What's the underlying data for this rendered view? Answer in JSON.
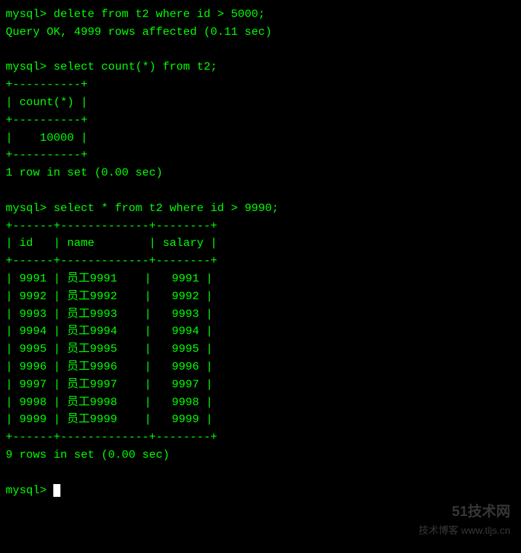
{
  "block1": {
    "prompt": "mysql> ",
    "command": "delete from t2 where id > 5000;",
    "result": "Query OK, 4999 rows affected (0.11 sec)"
  },
  "block2": {
    "prompt": "mysql> ",
    "command": "select count(*) from t2;",
    "border": "+----------+",
    "header": "| count(*) |",
    "row": "|    10000 |",
    "summary": "1 row in set (0.00 sec)",
    "chart_data": {
      "type": "table",
      "columns": [
        "count(*)"
      ],
      "rows": [
        [
          10000
        ]
      ]
    }
  },
  "block3": {
    "prompt": "mysql> ",
    "command": "select * from t2 where id > 9990;",
    "border": "+------+-------------+--------+",
    "header": "| id   | name        | salary |",
    "rows": [
      "| 9991 | 员工9991    |   9991 |",
      "| 9992 | 员工9992    |   9992 |",
      "| 9993 | 员工9993    |   9993 |",
      "| 9994 | 员工9994    |   9994 |",
      "| 9995 | 员工9995    |   9995 |",
      "| 9996 | 员工9996    |   9996 |",
      "| 9997 | 员工9997    |   9997 |",
      "| 9998 | 员工9998    |   9998 |",
      "| 9999 | 员工9999    |   9999 |"
    ],
    "summary": "9 rows in set (0.00 sec)",
    "chart_data": {
      "type": "table",
      "columns": [
        "id",
        "name",
        "salary"
      ],
      "rows": [
        [
          9991,
          "员工9991",
          9991
        ],
        [
          9992,
          "员工9992",
          9992
        ],
        [
          9993,
          "员工9993",
          9993
        ],
        [
          9994,
          "员工9994",
          9994
        ],
        [
          9995,
          "员工9995",
          9995
        ],
        [
          9996,
          "员工9996",
          9996
        ],
        [
          9997,
          "员工9997",
          9997
        ],
        [
          9998,
          "员工9998",
          9998
        ],
        [
          9999,
          "员工9999",
          9999
        ]
      ]
    }
  },
  "block4": {
    "prompt": "mysql> "
  },
  "watermark": {
    "line1": "51技术网",
    "line2": "技术博客 www.tljs.cn"
  }
}
